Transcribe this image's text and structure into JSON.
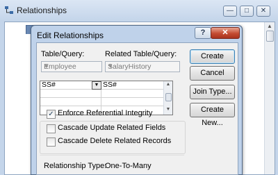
{
  "window": {
    "title": "Relationships",
    "minimize_glyph": "—",
    "maximize_glyph": "□",
    "close_glyph": "✕",
    "scroll_up_glyph": "▲"
  },
  "dialog": {
    "title": "Edit Relationships",
    "help_glyph": "?",
    "close_glyph": "✕",
    "table_query_label": "Table/Query:",
    "related_table_label": "Related Table/Query:",
    "table_query_value": "Employee",
    "related_table_value": "SalaryHistory",
    "combo_arrow_glyph": "▼",
    "fields": [
      {
        "left": "SS#",
        "right": "SS#"
      },
      {
        "left": "",
        "right": ""
      },
      {
        "left": "",
        "right": ""
      },
      {
        "left": "",
        "right": ""
      }
    ],
    "grid_scroll_up": "▲",
    "grid_scroll_down": "▼",
    "checkboxes": {
      "enforce": {
        "label": "Enforce Referential Integrity",
        "checked": true,
        "mark": "✓"
      },
      "cascade_update": {
        "label": "Cascade Update Related Fields",
        "checked": false
      },
      "cascade_delete": {
        "label": "Cascade Delete Related Records",
        "checked": false
      }
    },
    "relationship_type_label": "Relationship Type:",
    "relationship_type_value": "One-To-Many",
    "buttons": {
      "create": "Create",
      "cancel": "Cancel",
      "join_type": "Join Type...",
      "create_new": "Create New..."
    }
  }
}
